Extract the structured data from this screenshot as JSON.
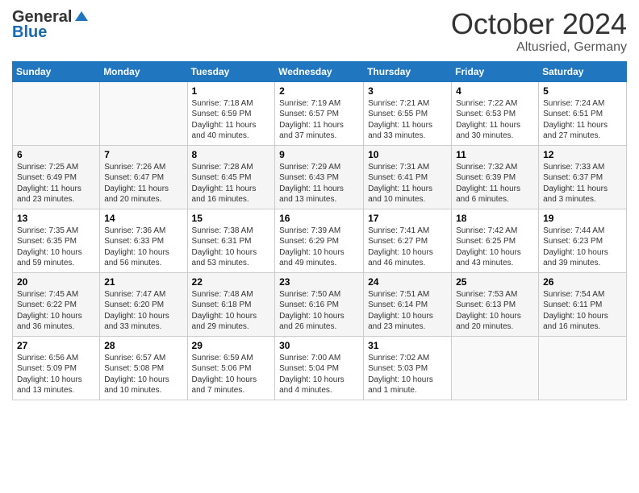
{
  "header": {
    "logo_general": "General",
    "logo_blue": "Blue",
    "month_title": "October 2024",
    "location": "Altusried, Germany"
  },
  "days_of_week": [
    "Sunday",
    "Monday",
    "Tuesday",
    "Wednesday",
    "Thursday",
    "Friday",
    "Saturday"
  ],
  "weeks": [
    [
      {
        "day": "",
        "empty": true
      },
      {
        "day": "",
        "empty": true
      },
      {
        "day": "1",
        "sunrise": "Sunrise: 7:18 AM",
        "sunset": "Sunset: 6:59 PM",
        "daylight": "Daylight: 11 hours and 40 minutes."
      },
      {
        "day": "2",
        "sunrise": "Sunrise: 7:19 AM",
        "sunset": "Sunset: 6:57 PM",
        "daylight": "Daylight: 11 hours and 37 minutes."
      },
      {
        "day": "3",
        "sunrise": "Sunrise: 7:21 AM",
        "sunset": "Sunset: 6:55 PM",
        "daylight": "Daylight: 11 hours and 33 minutes."
      },
      {
        "day": "4",
        "sunrise": "Sunrise: 7:22 AM",
        "sunset": "Sunset: 6:53 PM",
        "daylight": "Daylight: 11 hours and 30 minutes."
      },
      {
        "day": "5",
        "sunrise": "Sunrise: 7:24 AM",
        "sunset": "Sunset: 6:51 PM",
        "daylight": "Daylight: 11 hours and 27 minutes."
      }
    ],
    [
      {
        "day": "6",
        "sunrise": "Sunrise: 7:25 AM",
        "sunset": "Sunset: 6:49 PM",
        "daylight": "Daylight: 11 hours and 23 minutes."
      },
      {
        "day": "7",
        "sunrise": "Sunrise: 7:26 AM",
        "sunset": "Sunset: 6:47 PM",
        "daylight": "Daylight: 11 hours and 20 minutes."
      },
      {
        "day": "8",
        "sunrise": "Sunrise: 7:28 AM",
        "sunset": "Sunset: 6:45 PM",
        "daylight": "Daylight: 11 hours and 16 minutes."
      },
      {
        "day": "9",
        "sunrise": "Sunrise: 7:29 AM",
        "sunset": "Sunset: 6:43 PM",
        "daylight": "Daylight: 11 hours and 13 minutes."
      },
      {
        "day": "10",
        "sunrise": "Sunrise: 7:31 AM",
        "sunset": "Sunset: 6:41 PM",
        "daylight": "Daylight: 11 hours and 10 minutes."
      },
      {
        "day": "11",
        "sunrise": "Sunrise: 7:32 AM",
        "sunset": "Sunset: 6:39 PM",
        "daylight": "Daylight: 11 hours and 6 minutes."
      },
      {
        "day": "12",
        "sunrise": "Sunrise: 7:33 AM",
        "sunset": "Sunset: 6:37 PM",
        "daylight": "Daylight: 11 hours and 3 minutes."
      }
    ],
    [
      {
        "day": "13",
        "sunrise": "Sunrise: 7:35 AM",
        "sunset": "Sunset: 6:35 PM",
        "daylight": "Daylight: 10 hours and 59 minutes."
      },
      {
        "day": "14",
        "sunrise": "Sunrise: 7:36 AM",
        "sunset": "Sunset: 6:33 PM",
        "daylight": "Daylight: 10 hours and 56 minutes."
      },
      {
        "day": "15",
        "sunrise": "Sunrise: 7:38 AM",
        "sunset": "Sunset: 6:31 PM",
        "daylight": "Daylight: 10 hours and 53 minutes."
      },
      {
        "day": "16",
        "sunrise": "Sunrise: 7:39 AM",
        "sunset": "Sunset: 6:29 PM",
        "daylight": "Daylight: 10 hours and 49 minutes."
      },
      {
        "day": "17",
        "sunrise": "Sunrise: 7:41 AM",
        "sunset": "Sunset: 6:27 PM",
        "daylight": "Daylight: 10 hours and 46 minutes."
      },
      {
        "day": "18",
        "sunrise": "Sunrise: 7:42 AM",
        "sunset": "Sunset: 6:25 PM",
        "daylight": "Daylight: 10 hours and 43 minutes."
      },
      {
        "day": "19",
        "sunrise": "Sunrise: 7:44 AM",
        "sunset": "Sunset: 6:23 PM",
        "daylight": "Daylight: 10 hours and 39 minutes."
      }
    ],
    [
      {
        "day": "20",
        "sunrise": "Sunrise: 7:45 AM",
        "sunset": "Sunset: 6:22 PM",
        "daylight": "Daylight: 10 hours and 36 minutes."
      },
      {
        "day": "21",
        "sunrise": "Sunrise: 7:47 AM",
        "sunset": "Sunset: 6:20 PM",
        "daylight": "Daylight: 10 hours and 33 minutes."
      },
      {
        "day": "22",
        "sunrise": "Sunrise: 7:48 AM",
        "sunset": "Sunset: 6:18 PM",
        "daylight": "Daylight: 10 hours and 29 minutes."
      },
      {
        "day": "23",
        "sunrise": "Sunrise: 7:50 AM",
        "sunset": "Sunset: 6:16 PM",
        "daylight": "Daylight: 10 hours and 26 minutes."
      },
      {
        "day": "24",
        "sunrise": "Sunrise: 7:51 AM",
        "sunset": "Sunset: 6:14 PM",
        "daylight": "Daylight: 10 hours and 23 minutes."
      },
      {
        "day": "25",
        "sunrise": "Sunrise: 7:53 AM",
        "sunset": "Sunset: 6:13 PM",
        "daylight": "Daylight: 10 hours and 20 minutes."
      },
      {
        "day": "26",
        "sunrise": "Sunrise: 7:54 AM",
        "sunset": "Sunset: 6:11 PM",
        "daylight": "Daylight: 10 hours and 16 minutes."
      }
    ],
    [
      {
        "day": "27",
        "sunrise": "Sunrise: 6:56 AM",
        "sunset": "Sunset: 5:09 PM",
        "daylight": "Daylight: 10 hours and 13 minutes."
      },
      {
        "day": "28",
        "sunrise": "Sunrise: 6:57 AM",
        "sunset": "Sunset: 5:08 PM",
        "daylight": "Daylight: 10 hours and 10 minutes."
      },
      {
        "day": "29",
        "sunrise": "Sunrise: 6:59 AM",
        "sunset": "Sunset: 5:06 PM",
        "daylight": "Daylight: 10 hours and 7 minutes."
      },
      {
        "day": "30",
        "sunrise": "Sunrise: 7:00 AM",
        "sunset": "Sunset: 5:04 PM",
        "daylight": "Daylight: 10 hours and 4 minutes."
      },
      {
        "day": "31",
        "sunrise": "Sunrise: 7:02 AM",
        "sunset": "Sunset: 5:03 PM",
        "daylight": "Daylight: 10 hours and 1 minute."
      },
      {
        "day": "",
        "empty": true
      },
      {
        "day": "",
        "empty": true
      }
    ]
  ]
}
